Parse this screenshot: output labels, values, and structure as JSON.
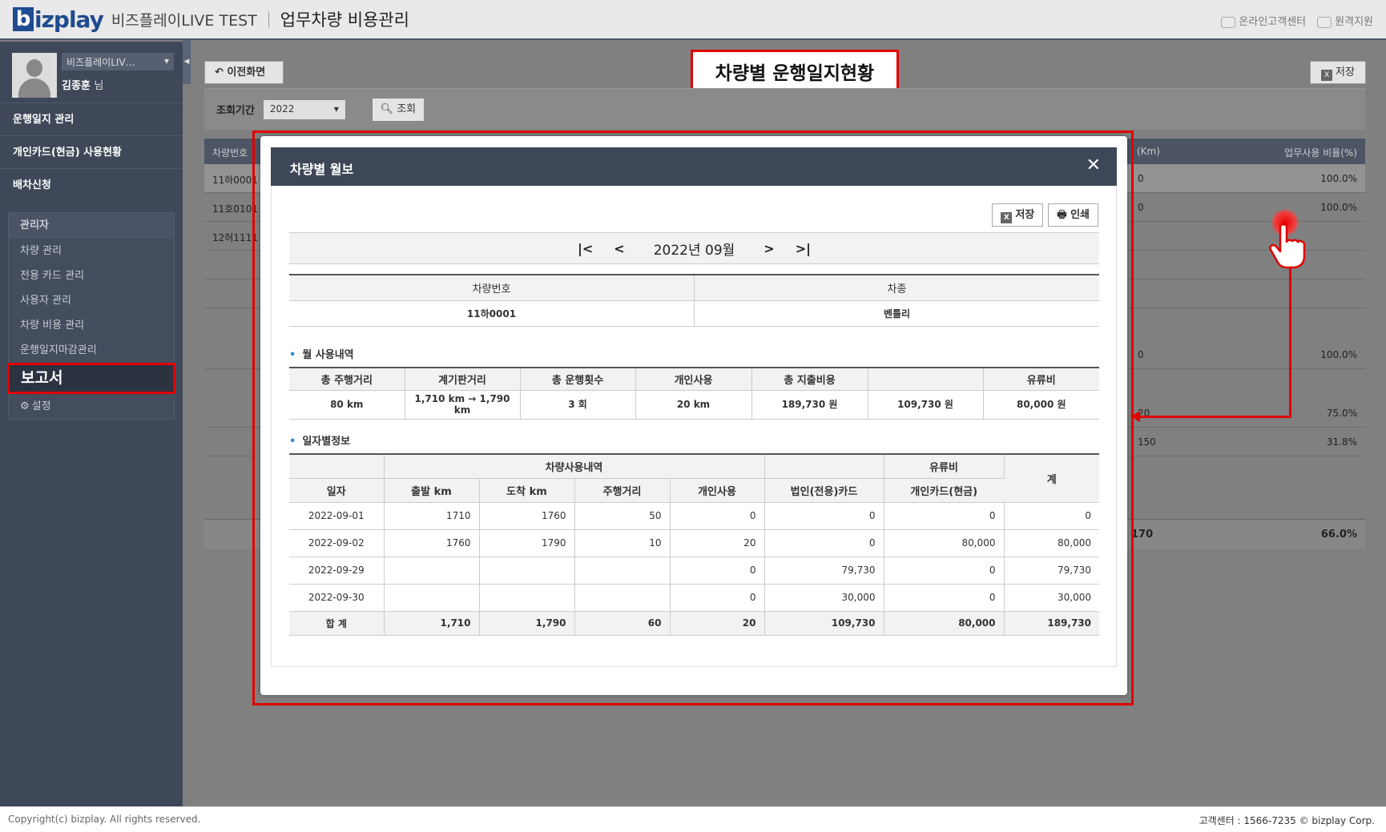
{
  "header": {
    "logo_b": "b",
    "logo_rest": "izplay",
    "company": "비즈플레이LIVE TEST",
    "app_title": "업무차량 비용관리",
    "online_center": "온라인고객센터",
    "remote_support": "원격지원"
  },
  "sidebar": {
    "company_select": "비즈플레이LIV…",
    "user_name": "김종훈",
    "user_suffix": "님",
    "menu": [
      {
        "label": "운행일지 관리"
      },
      {
        "label": "개인카드(현금) 사용현황"
      },
      {
        "label": "배차신청"
      }
    ],
    "admin_title": "관리자",
    "admin_items": [
      {
        "label": "차량 관리"
      },
      {
        "label": "전용 카드 관리"
      },
      {
        "label": "사용자 관리"
      },
      {
        "label": "차량 비용 관리"
      },
      {
        "label": "운행일지마감관리"
      },
      {
        "label": "보고서"
      },
      {
        "label": "설정"
      }
    ]
  },
  "main": {
    "back_label": "이전화면",
    "save_label": "저장",
    "page_title": "차량별 운행일지현황",
    "search_label": "조회기간",
    "year_value": "2022",
    "search_button": "조회",
    "table_header": {
      "c1": "차량번호",
      "c2": "(Km)",
      "c3": "업무사용 비율(%)"
    },
    "rows": [
      {
        "a": "11하0001",
        "b": "0",
        "c": "100.0%"
      },
      {
        "a": "11호0101",
        "b": "0",
        "c": "100.0%"
      },
      {
        "a": "12허1111",
        "b": "",
        "c": ""
      },
      {
        "a": "",
        "b": "0",
        "c": "100.0%"
      },
      {
        "a": "",
        "b": "20",
        "c": "75.0%"
      },
      {
        "a": "",
        "b": "150",
        "c": "31.8%"
      }
    ],
    "total": {
      "b": "170",
      "c": "66.0%"
    }
  },
  "modal": {
    "title": "차량별 월보",
    "close": "✕",
    "save_label": "저장",
    "print_label": "인쇄",
    "nav": {
      "first": "|<",
      "prev": "<",
      "month": "2022년 09월",
      "next": ">",
      "last": ">|"
    },
    "vehicle": {
      "h1": "차량번호",
      "h2": "차종",
      "v1": "11하0001",
      "v2": "벤틀리"
    },
    "monthly_title": "월 사용내역",
    "monthly_headers": [
      "총 주행거리",
      "계기판거리",
      "총 운행횟수",
      "개인사용",
      "총 지출비용",
      "",
      "유류비"
    ],
    "monthly_values": [
      "80 km",
      "1,710 km → 1,790 km",
      "3 회",
      "20 km",
      "189,730 원",
      "109,730 원",
      "80,000 원"
    ],
    "daily_title": "일자별정보",
    "daily_group1": "차량사용내역",
    "daily_group2": "유류비",
    "daily_headers": {
      "date": "일자",
      "start": "출발 km",
      "end": "도착 km",
      "dist": "주행거리",
      "personal": "개인사용",
      "corp": "법인(전용)카드",
      "pcard": "개인카드(현금)",
      "sum": "계"
    },
    "daily_rows": [
      [
        "2022-09-01",
        "1710",
        "1760",
        "50",
        "0",
        "0",
        "0",
        "0"
      ],
      [
        "2022-09-02",
        "1760",
        "1790",
        "10",
        "20",
        "0",
        "80,000",
        "80,000"
      ],
      [
        "2022-09-29",
        "",
        "",
        "",
        "0",
        "79,730",
        "0",
        "79,730"
      ],
      [
        "2022-09-30",
        "",
        "",
        "",
        "0",
        "30,000",
        "0",
        "30,000"
      ]
    ],
    "daily_total": [
      "합 계",
      "1,710",
      "1,790",
      "60",
      "20",
      "109,730",
      "80,000",
      "189,730"
    ]
  },
  "footer": {
    "copyright": "Copyright(c) bizplay. All rights reserved.",
    "support": "고객센터 : 1566-7235 © bizplay Corp."
  }
}
